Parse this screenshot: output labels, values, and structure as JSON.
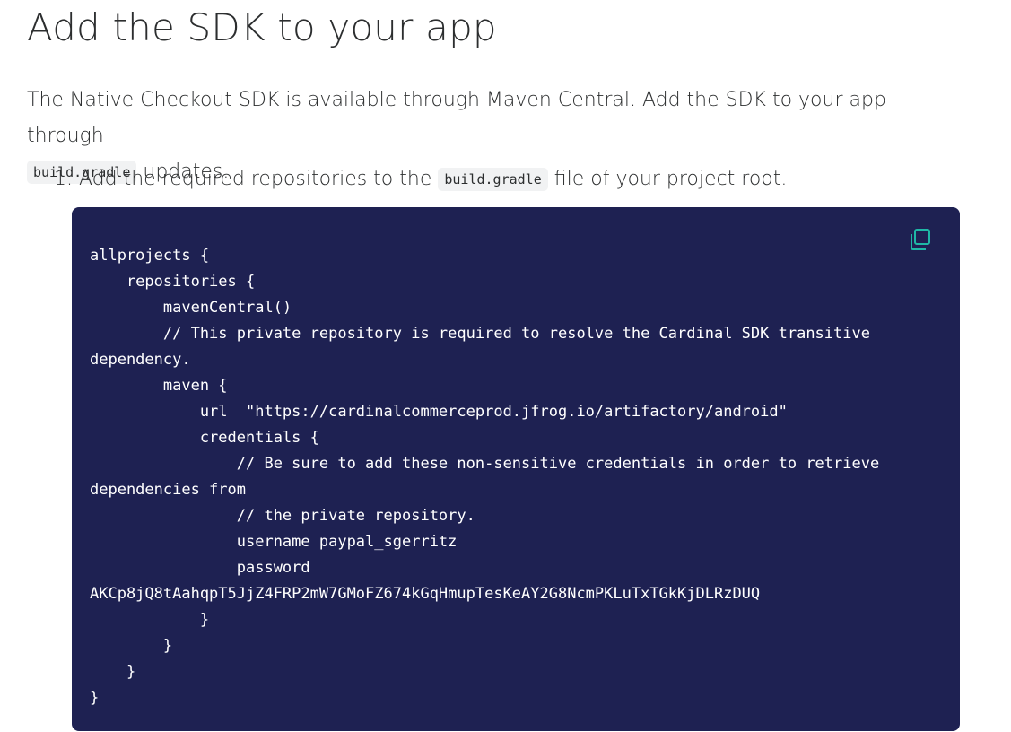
{
  "heading": "Add the SDK to your app",
  "intro": {
    "text_before": "The Native Checkout SDK is available through Maven Central. Add the SDK to your app through",
    "code": "build.gradle",
    "text_after": "updates."
  },
  "steps": [
    {
      "number": "1.",
      "text_before": "Add the required repositories to the",
      "code": "build.gradle",
      "text_after": "file of your project root."
    }
  ],
  "code_block": {
    "background_color": "#1e2152",
    "copy_icon": "copy-icon",
    "copy_icon_color": "#1fb8a6",
    "lines": [
      "allprojects {",
      "    repositories {",
      "        mavenCentral()",
      "        // This private repository is required to resolve the Cardinal SDK transitive",
      "dependency.",
      "        maven {",
      "            url  \"https://cardinalcommerceprod.jfrog.io/artifactory/android\"",
      "            credentials {",
      "                // Be sure to add these non-sensitive credentials in order to retrieve",
      "dependencies from",
      "                // the private repository.",
      "                username paypal_sgerritz",
      "                password",
      "AKCp8jQ8tAahqpT5JjZ4FRP2mW7GMoFZ674kGqHmupTesKeAY2G8NcmPKLuTxTGkKjDLRzDUQ",
      "            }",
      "        }",
      "    }",
      "}"
    ]
  }
}
